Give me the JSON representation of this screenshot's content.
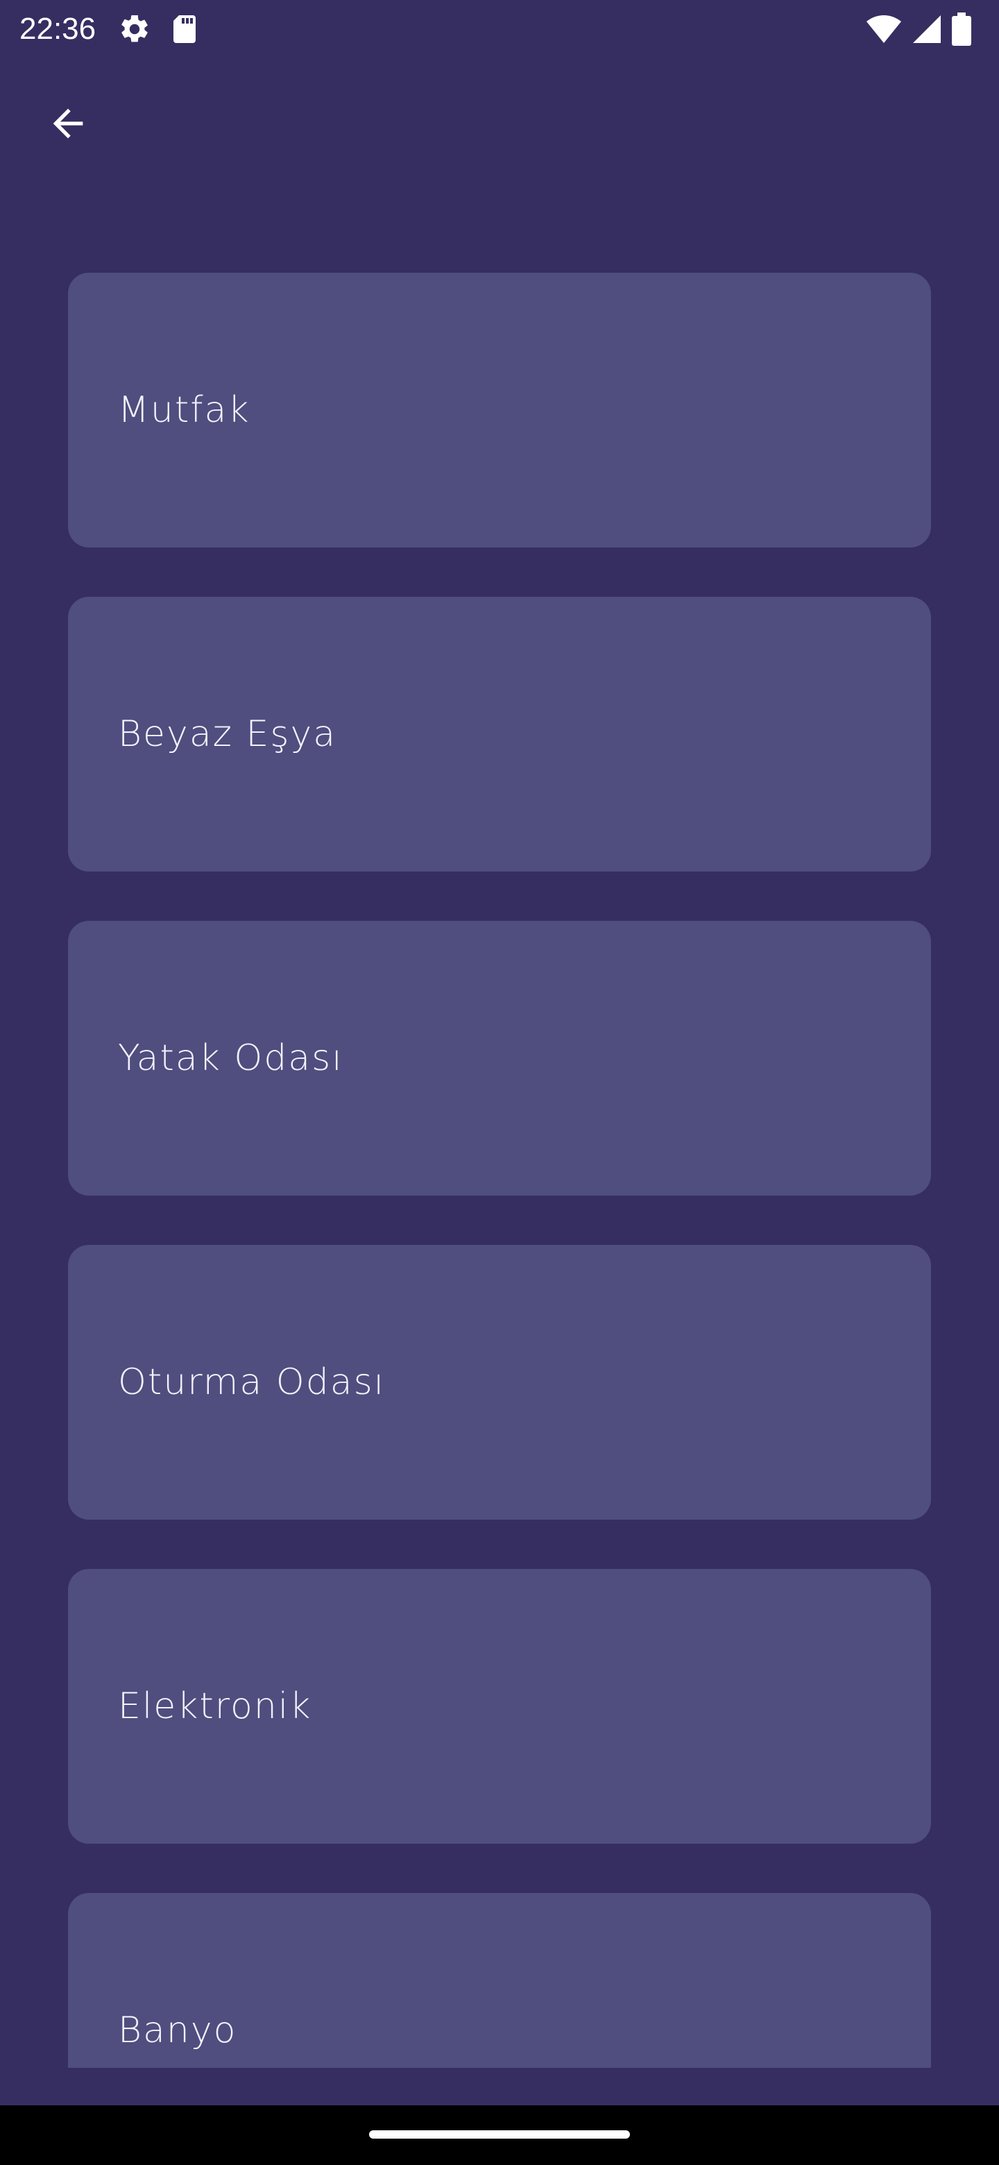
{
  "status_bar": {
    "time": "22:36",
    "left_icons": [
      "gear-icon",
      "sd-card-icon"
    ],
    "right_icons": [
      "wifi-icon",
      "cellular-signal-icon",
      "battery-icon"
    ]
  },
  "header": {
    "back_icon": "arrow-left-icon"
  },
  "categories": [
    {
      "label": "Mutfak"
    },
    {
      "label": "Beyaz Eşya"
    },
    {
      "label": "Yatak Odası"
    },
    {
      "label": "Oturma Odası"
    },
    {
      "label": "Elektronik"
    },
    {
      "label": "Banyo"
    }
  ],
  "colors": {
    "background": "#362e61",
    "card": "#4f4e7e",
    "text": "#f2f1fb",
    "nav_bar": "#000000"
  }
}
